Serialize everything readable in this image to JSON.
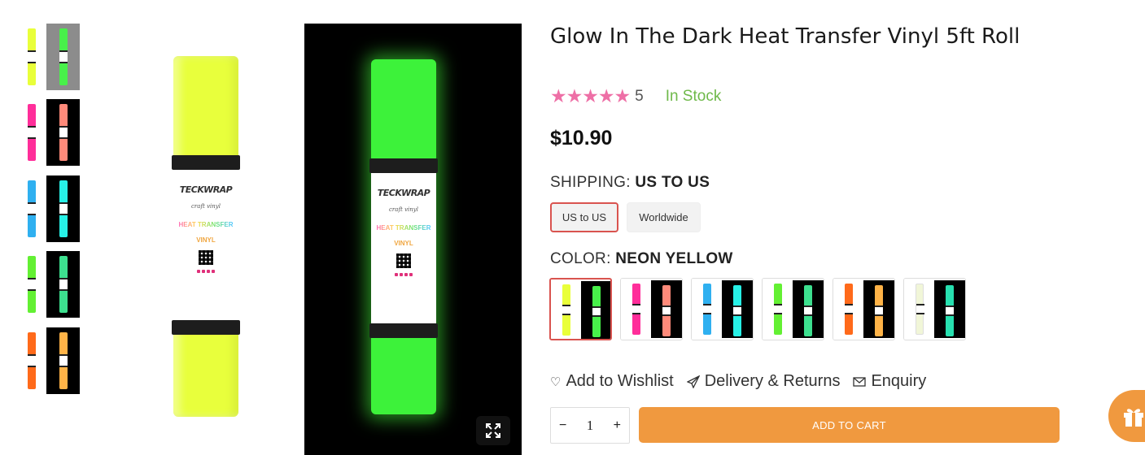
{
  "product": {
    "title": "Glow In The Dark Heat Transfer Vinyl 5ft Roll",
    "stars": "★★★★★",
    "rating_count": "5",
    "stock_status": "In Stock",
    "price": "$10.90",
    "accent_color": "#f0993f",
    "star_color": "#ee6fa6",
    "stock_color": "#6fb94a"
  },
  "roll_label": {
    "brand": "TECKWRAP",
    "script": "craft vinyl",
    "line1": "HEAT TRANSFER",
    "line2": "VINYL"
  },
  "shipping": {
    "label": "SHIPPING:",
    "selected": "US TO US",
    "options": [
      "US to US",
      "Worldwide"
    ]
  },
  "color": {
    "label": "COLOR:",
    "selected": "NEON YELLOW",
    "swatches": [
      {
        "name": "neon-yellow",
        "light": "#e9ff3a",
        "glow": "#48f04a"
      },
      {
        "name": "pink",
        "light": "#ff2e9a",
        "glow": "#ff8a7a"
      },
      {
        "name": "blue",
        "light": "#2fb0f0",
        "glow": "#27f0e6"
      },
      {
        "name": "green",
        "light": "#63f033",
        "glow": "#3de08f"
      },
      {
        "name": "orange",
        "light": "#ff6a1a",
        "glow": "#ffb347"
      },
      {
        "name": "white",
        "light": "#f1f6d8",
        "glow": "#27e0b0"
      }
    ]
  },
  "links": {
    "wishlist": "Add to Wishlist",
    "delivery": "Delivery & Returns",
    "enquiry": "Enquiry"
  },
  "cart": {
    "quantity": "1",
    "minus": "−",
    "plus": "+",
    "add_label": "ADD TO CART"
  }
}
